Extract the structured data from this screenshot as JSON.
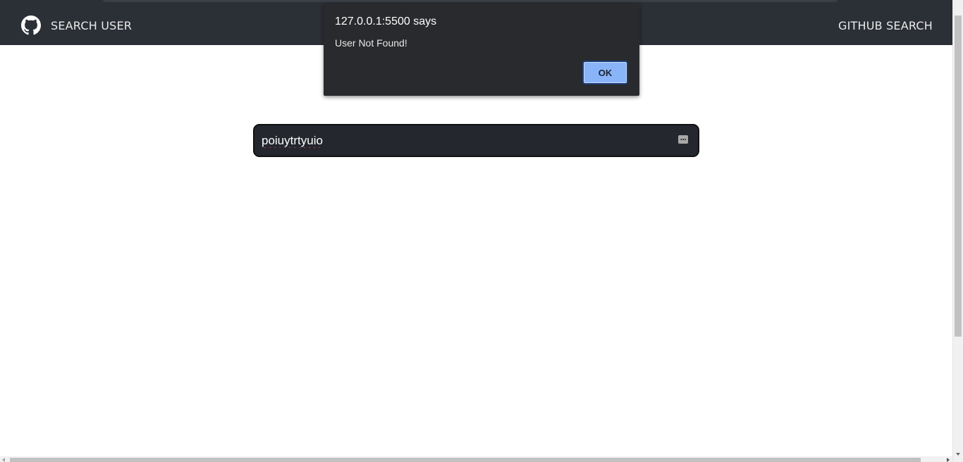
{
  "navbar": {
    "brand_label": "SEARCH USER",
    "right_label": "GITHUB SEARCH",
    "brand_icon": "github-icon",
    "background": "#2b2f36"
  },
  "search": {
    "value": "poiuytrtyuio",
    "input_icon": "password-manager-icon"
  },
  "dialog": {
    "title": "127.0.0.1:5500 says",
    "message": "User Not Found!",
    "ok_label": "OK",
    "accent": "#8ab4f8"
  }
}
